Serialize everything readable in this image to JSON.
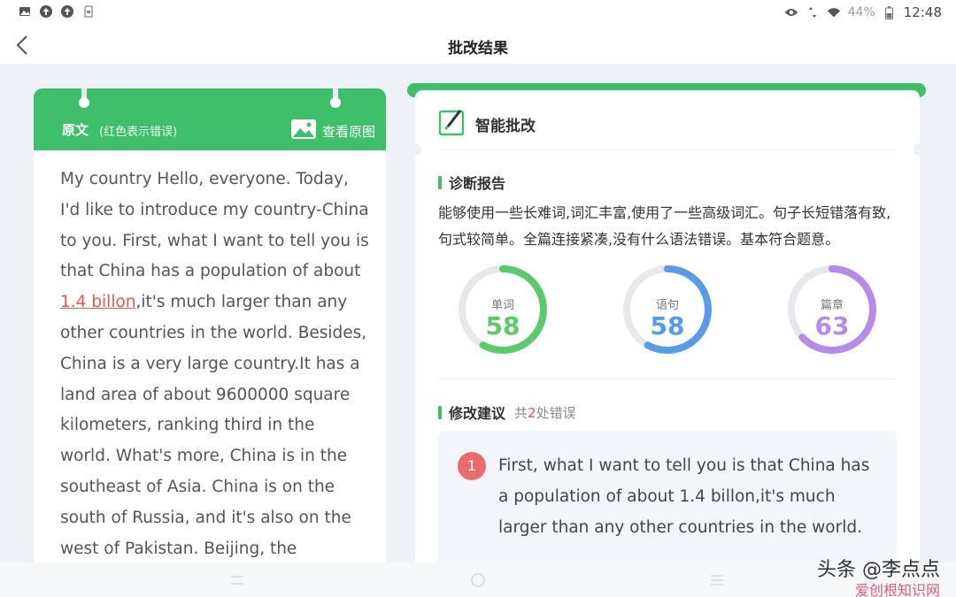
{
  "status_bar": {
    "battery": "44%",
    "time": "12:48"
  },
  "header": {
    "title": "批改结果"
  },
  "left_panel": {
    "title": "原文",
    "subtitle": "(红色表示错误)",
    "view_original": "查看原图",
    "essay_before": "My country  Hello, everyone. Today, I'd like to introduce my country-China to you.  First, what I want to tell you is that China has a population of about ",
    "essay_error": "1.4 billon",
    "essay_after": ",it's much larger than any other countries in the world. Besides, China is a very large country.It has a land area of about 9600000 square kilometers, ranking third in the world. What's more, China is in the southeast of Asia. China is on the south of Russia, and it's also on the west of Pakistan. Beijing, the"
  },
  "right_panel": {
    "section_title": "智能批改",
    "diagnosis": {
      "label": "诊断报告",
      "text": "能够使用一些长难词,词汇丰富,使用了一些高级词汇。句子长短错落有致,句式较简单。全篇连接紧凑,没有什么语法错误。基本符合题意。"
    },
    "scores": [
      {
        "label": "单词",
        "value": 58,
        "fraction": 0.58,
        "color": "#5cc96a"
      },
      {
        "label": "语句",
        "value": 58,
        "fraction": 0.58,
        "color": "#5a9be8"
      },
      {
        "label": "篇章",
        "value": 63,
        "fraction": 0.63,
        "color": "#b58be8"
      }
    ],
    "suggestions": {
      "label": "修改建议",
      "count_prefix": "共",
      "count": "2",
      "count_suffix": "处错误",
      "items": [
        {
          "number": "1",
          "text": "First, what I want to tell you is that China has a population of about 1.4 billon,it's much larger than any other countries in the world."
        }
      ]
    }
  },
  "watermark": {
    "line1": "头条 @李点点",
    "line2": "爱创根知识网"
  },
  "colors": {
    "accent_green": "#3fbf6a",
    "error_red": "#e0585a"
  }
}
